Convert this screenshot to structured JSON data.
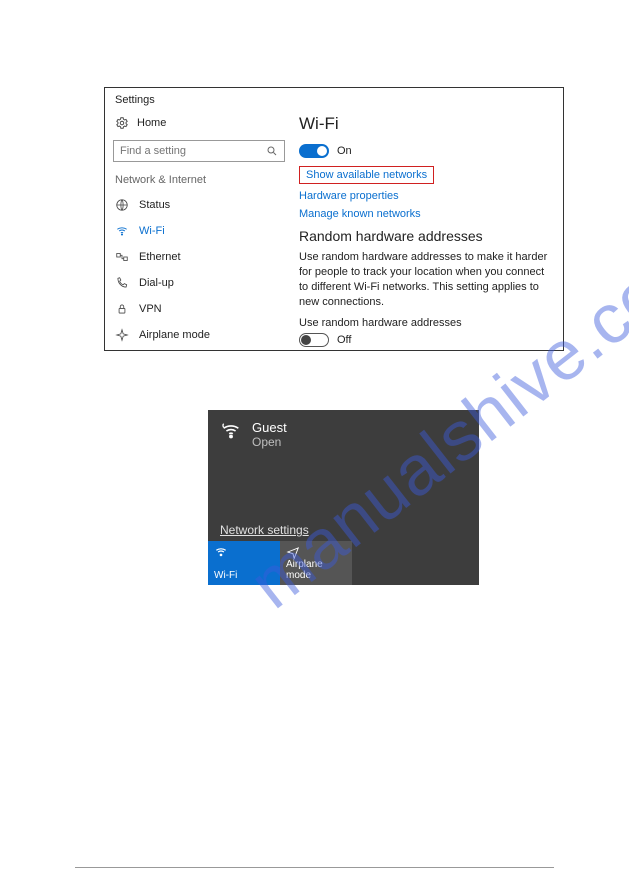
{
  "watermark": "manualshive.com",
  "settings": {
    "window_title": "Settings",
    "home_label": "Home",
    "search_placeholder": "Find a setting",
    "section_label": "Network & Internet",
    "nav": {
      "status": "Status",
      "wifi": "Wi-Fi",
      "ethernet": "Ethernet",
      "dialup": "Dial-up",
      "vpn": "VPN",
      "airplane": "Airplane mode"
    },
    "content": {
      "title": "Wi-Fi",
      "toggle_on_label": "On",
      "show_available": "Show available networks",
      "hardware_props": "Hardware properties",
      "manage_known": "Manage known networks",
      "rha_heading": "Random hardware addresses",
      "rha_desc": "Use random hardware addresses to make it harder for people to track your location when you connect to different Wi-Fi networks. This setting applies to new connections.",
      "rha_toggle_label": "Use random hardware addresses",
      "toggle_off_label": "Off"
    }
  },
  "flyout": {
    "network_name": "Guest",
    "network_status": "Open",
    "settings_link": "Network settings",
    "tiles": {
      "wifi": "Wi-Fi",
      "airplane": "Airplane mode"
    }
  }
}
